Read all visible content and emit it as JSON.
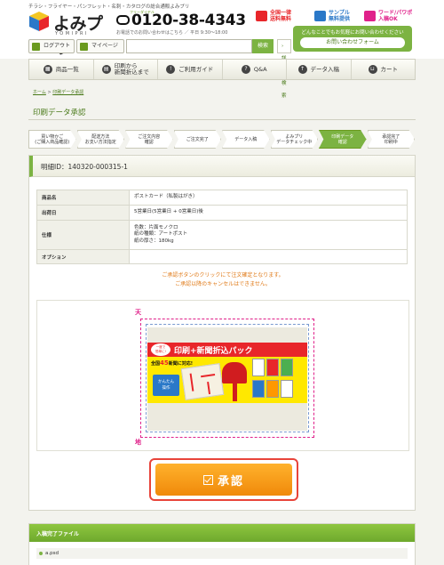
{
  "header": {
    "tagline": "チラシ・フライヤー・パンフレット・名刺・カタログの総合通販よみプリ",
    "logo_text": "よみプリ",
    "logo_roman": "YOMIPRI",
    "tel_label": "フリーダイヤル",
    "tel": "0120-38-4343",
    "tel_hours": "お電話でのお問い合わせはこちら ／ 平日 9:30〜18:00",
    "badges": [
      {
        "label": "全国一律\n送料無料",
        "icon": "truck-icon",
        "color": "#e8262a"
      },
      {
        "label": "サンプル\n無料提供",
        "icon": "sample-icon",
        "color": "#2a78c8"
      },
      {
        "label": "ワード/パワポ\n入稿OK",
        "icon": "office-icon",
        "color": "#e0218a"
      }
    ],
    "cta_note": "どんなことでもお気軽にお問い合わせください",
    "cta_button": "お問い合わせフォーム",
    "login": "ログアウト",
    "mypage": "マイページ",
    "search_placeholder": "",
    "search_button": "検索",
    "advanced_search": "詳細検索"
  },
  "nav": [
    {
      "label": "商品一覧",
      "icon": "grid-icon"
    },
    {
      "label": "印刷から\n新聞折込まで",
      "icon": "print-icon"
    },
    {
      "label": "ご利用ガイド",
      "icon": "guide-icon"
    },
    {
      "label": "Q&A",
      "icon": "question-icon"
    },
    {
      "label": "データ入稿",
      "icon": "upload-icon"
    },
    {
      "label": "カート",
      "icon": "cart-icon"
    }
  ],
  "breadcrumb": {
    "home": "ホーム",
    "separator": ">",
    "current": "印刷データ承認"
  },
  "page_title": "印刷データ承認",
  "steps": [
    {
      "label": "買い物かご\n(ご購入商品確認)",
      "active": false
    },
    {
      "label": "配送方法\nお支い方法指定",
      "active": false
    },
    {
      "label": "ご注文内容\n確認",
      "active": false
    },
    {
      "label": "ご注文完了",
      "active": false
    },
    {
      "label": "データ入稿",
      "active": false
    },
    {
      "label": "よみプリ\nデータチェック中",
      "active": false
    },
    {
      "label": "印刷データ\n確認",
      "active": true
    },
    {
      "label": "承認完了\n印刷中",
      "active": false
    }
  ],
  "detail": {
    "id_label": "明細ID：140320-000315-1",
    "rows": [
      {
        "key": "商品名",
        "value": "ポストカード（私製はがき）"
      },
      {
        "key": "出荷日",
        "value": "5営業日(5営業日 + 0営業日)後"
      },
      {
        "key": "仕様",
        "value": "色数：片面モノクロ\n紙の種類：アートポスト\n紙の厚さ：180kg"
      },
      {
        "key": "オプション",
        "value": ""
      }
    ],
    "notice_1": "ご承認ボタンのクリックにて注文確定となります。",
    "notice_2": "ご承認以降のキャンセルはできません。",
    "proof_top": "天",
    "proof_bottom": "地",
    "flyer_title": "印刷+新聞折込パック",
    "flyer_badge": "一度で\n簡単に!",
    "flyer_sub_prefix": "全国",
    "flyer_sub_num": "45",
    "flyer_sub_suffix": "新聞に対応!",
    "flyer_easy": "かんたん\n操作",
    "approve_label": "承認"
  },
  "files": {
    "title": "入稿完了ファイル",
    "items": [
      "a.psd"
    ]
  }
}
